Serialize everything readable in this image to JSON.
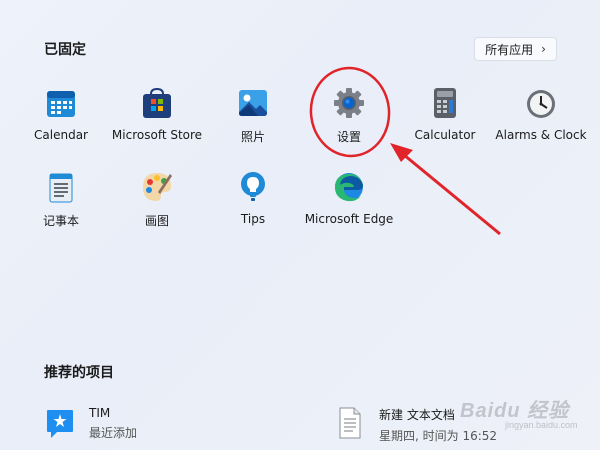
{
  "start_menu": {
    "pinned_title": "已固定",
    "all_apps_label": "所有应用",
    "pinned_apps": [
      {
        "label": "Calendar",
        "icon": "calendar-icon"
      },
      {
        "label": "Microsoft Store",
        "icon": "store-icon"
      },
      {
        "label": "照片",
        "icon": "photos-icon"
      },
      {
        "label": "设置",
        "icon": "settings-gear-icon"
      },
      {
        "label": "Calculator",
        "icon": "calculator-icon"
      },
      {
        "label": "Alarms & Clock",
        "icon": "clock-icon"
      },
      {
        "label": "记事本",
        "icon": "notepad-icon"
      },
      {
        "label": "画图",
        "icon": "paint-icon"
      },
      {
        "label": "Tips",
        "icon": "lightbulb-icon"
      },
      {
        "label": "Microsoft Edge",
        "icon": "edge-icon"
      }
    ],
    "recommended_title": "推荐的项目",
    "recommended": [
      {
        "name": "TIM",
        "sub": "最近添加",
        "icon": "tim-icon"
      },
      {
        "name": "新建 文本文档",
        "sub": "星期四, 时间为 16:52",
        "icon": "text-document-icon"
      }
    ]
  },
  "watermark": {
    "text": "Baidu 经验",
    "sub": "jingyan.baidu.com"
  },
  "colors": {
    "accent": "#0067c0",
    "annotation_red": "#e0242a"
  }
}
